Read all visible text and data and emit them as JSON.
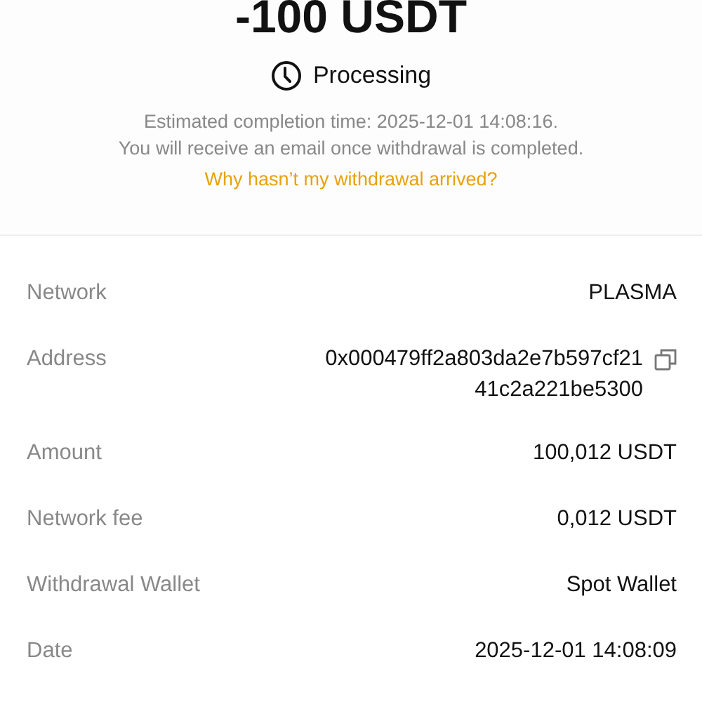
{
  "amount": "-100 USDT",
  "status": {
    "kind": "processing",
    "label": "Processing"
  },
  "notes": [
    "Estimated completion time: 2025-12-01 14:08:16.",
    "You will receive an email once withdrawal is completed."
  ],
  "help_link": "Why hasn’t my withdrawal arrived?",
  "details": [
    {
      "label": "Network",
      "value": [
        "PLASMA"
      ],
      "copyable": false
    },
    {
      "label": "Address",
      "value": [
        "0x000479ff2a803da2e7b597cf21",
        "41c2a221be5300"
      ],
      "copyable": true
    },
    {
      "label": "Amount",
      "value": [
        "100,012 USDT"
      ],
      "copyable": false
    },
    {
      "label": "Network fee",
      "value": [
        "0,012 USDT"
      ],
      "copyable": false
    },
    {
      "label": "Withdrawal Wallet",
      "value": [
        "Spot Wallet"
      ],
      "copyable": false
    },
    {
      "label": "Date",
      "value": [
        "2025-12-01 14:08:09"
      ],
      "copyable": false
    }
  ]
}
